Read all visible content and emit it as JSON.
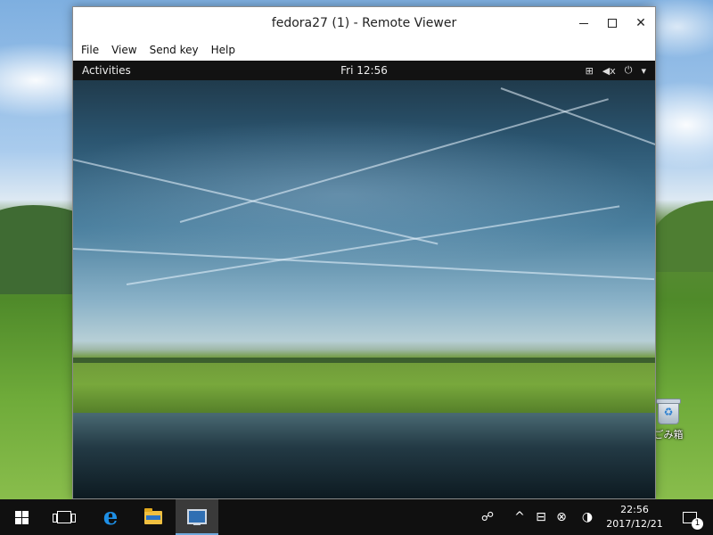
{
  "window": {
    "title": "fedora27 (1) - Remote Viewer",
    "controls": {
      "minimize_icon": "minimize-icon",
      "maximize_icon": "maximize-icon",
      "close_label": "✕"
    },
    "menu": [
      "File",
      "View",
      "Send key",
      "Help"
    ]
  },
  "guest": {
    "activities_label": "Activities",
    "clock": "Fri 12:56",
    "tray_icons": [
      "network-icon",
      "volume-muted-icon",
      "power-icon",
      "chevron-down-icon"
    ]
  },
  "desktop": {
    "recycle_bin_label": "ごみ箱"
  },
  "taskbar": {
    "apps": [
      "start-icon",
      "task-view-icon",
      "edge-icon",
      "file-explorer-icon",
      "remote-viewer-icon"
    ],
    "tray_icons": [
      "people-icon",
      "chevron-up-icon",
      "network-icon",
      "close-circle-icon",
      "night-light-icon"
    ],
    "time": "22:56",
    "date": "2017/12/21",
    "notification_count": "1"
  }
}
